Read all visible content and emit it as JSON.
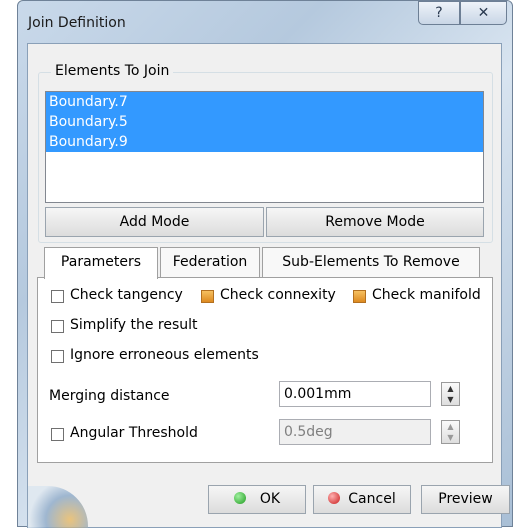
{
  "window": {
    "title": "Join Definition",
    "help_glyph": "?",
    "close_glyph": "✕"
  },
  "elements_group": {
    "label": "Elements To Join",
    "items": [
      "Boundary.7",
      "Boundary.5",
      "Boundary.9"
    ],
    "add_mode_label": "Add Mode",
    "remove_mode_label": "Remove Mode"
  },
  "tabs": [
    {
      "label": "Parameters",
      "active": true
    },
    {
      "label": "Federation",
      "active": false
    },
    {
      "label": "Sub-Elements To Remove",
      "active": false
    }
  ],
  "parameters": {
    "check_tangency": {
      "label": "Check tangency",
      "checked": false
    },
    "check_connexity": {
      "label": "Check connexity",
      "checked": true
    },
    "check_manifold": {
      "label": "Check manifold",
      "checked": true
    },
    "simplify": {
      "label": "Simplify the result",
      "checked": false
    },
    "ignore_erroneous": {
      "label": "Ignore erroneous elements",
      "checked": false
    },
    "merging_distance": {
      "label": "Merging distance",
      "value": "0.001mm"
    },
    "angular_threshold": {
      "label": "Angular Threshold",
      "checked": false,
      "value": "0.5deg",
      "enabled": false
    }
  },
  "footer": {
    "ok_label": "OK",
    "cancel_label": "Cancel",
    "preview_label": "Preview"
  },
  "colors": {
    "selection": "#3399ff",
    "checked_box": "#dd8a20",
    "ok_icon": "#1f9a1f",
    "cancel_icon": "#c81c1c"
  }
}
